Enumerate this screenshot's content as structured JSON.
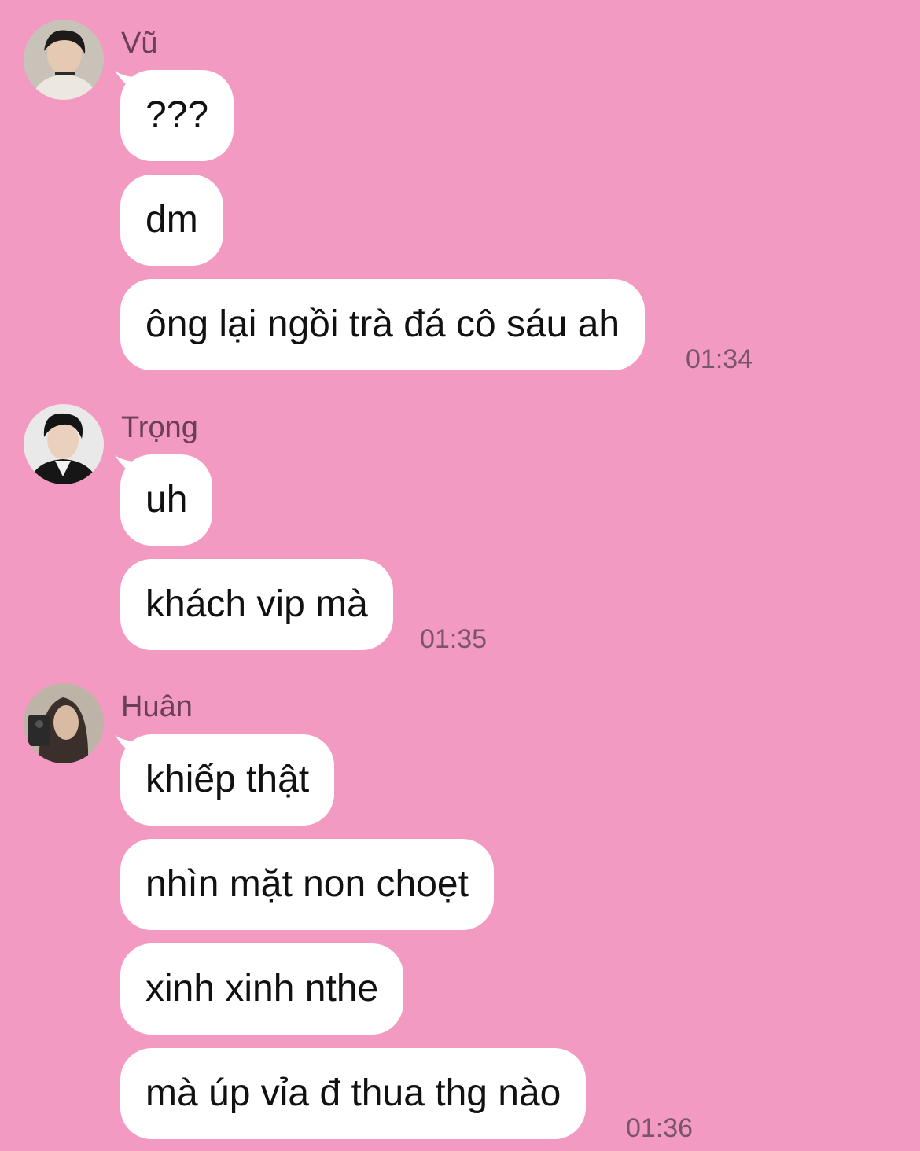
{
  "groups": [
    {
      "sender": "Vũ",
      "avatar_icon": "person-avatar-icon",
      "messages": [
        "???",
        "dm",
        "ông lại ngồi trà đá cô sáu ah"
      ],
      "time": "01:34"
    },
    {
      "sender": "Trọng",
      "avatar_icon": "person-avatar-icon",
      "messages": [
        "uh",
        "khách vip mà"
      ],
      "time": "01:35"
    },
    {
      "sender": "Huân",
      "avatar_icon": "person-avatar-icon",
      "messages": [
        "khiếp thật",
        "nhìn mặt non choẹt",
        "xinh xinh nthe",
        "mà úp vỉa đ thua thg nào"
      ],
      "time": "01:36"
    }
  ],
  "colors": {
    "background": "#f29ac1",
    "bubble": "#ffffff",
    "name": "#6b3f55",
    "timestamp": "#7a5568"
  }
}
